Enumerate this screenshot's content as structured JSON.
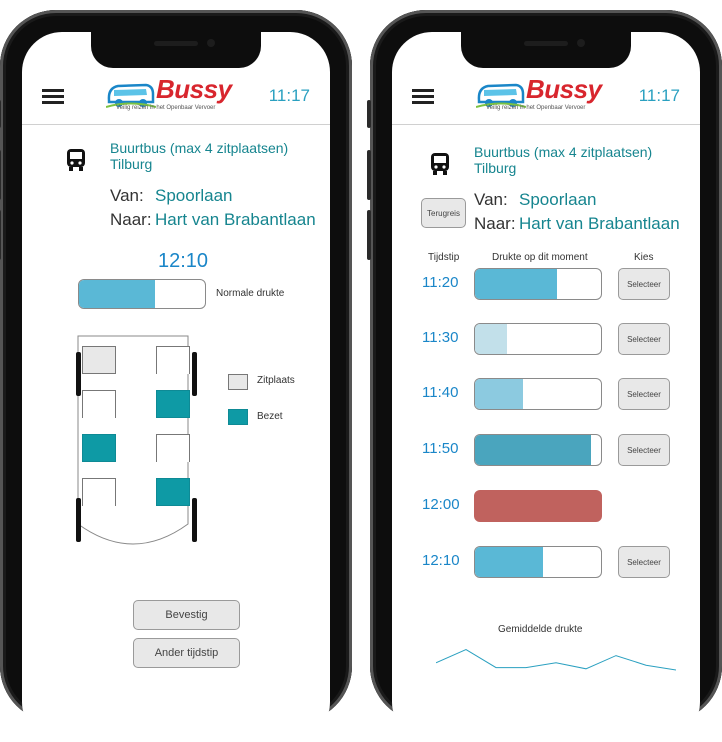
{
  "colors": {
    "teal_text": "#16858f",
    "time_blue": "#2aa0c0",
    "seat_taken": "#0e9aa5",
    "seat_free": "#e8e8e8",
    "bar_red": "#c0625e"
  },
  "header": {
    "time": "11:17",
    "logo_text": "Bussy",
    "logo_tagline": "Veilig reizen in het Openbaar Vervoer",
    "menu_icon": "hamburger-menu-icon"
  },
  "left": {
    "bus_title": "Buurtbus (max 4 zitplaatsen)",
    "bus_city": "Tilburg",
    "van_label": "Van:",
    "van_value": "Spoorlaan",
    "naar_label": "Naar:",
    "naar_value": "Hart van Brabantlaan",
    "departure_time": "12:10",
    "crowd_fraction": 0.6,
    "crowd_label": "Normale drukte",
    "legend_free": "Zitplaats",
    "legend_taken": "Bezet",
    "seats": [
      "free",
      "open",
      "open",
      "taken",
      "taken",
      "open",
      "open",
      "taken"
    ],
    "confirm_button": "Bevestig",
    "other_time_button": "Ander tijdstip"
  },
  "right": {
    "bus_title": "Buurtbus (max 4 zitplaatsen)",
    "bus_city": "Tilburg",
    "return_button": "Terugreis",
    "van_label": "Van:",
    "van_value": "Spoorlaan",
    "naar_label": "Naar:",
    "naar_value": "Hart van Brabantlaan",
    "col_time": "Tijdstip",
    "col_crowd": "Drukte op dit moment",
    "col_choose": "Kies",
    "select_label": "Selecteer",
    "rows": [
      {
        "time": "11:20",
        "fraction": 0.65,
        "color": "#5ab8d6",
        "selectable": true
      },
      {
        "time": "11:30",
        "fraction": 0.25,
        "color": "#c2e0ea",
        "selectable": true
      },
      {
        "time": "11:40",
        "fraction": 0.38,
        "color": "#8ccae0",
        "selectable": true
      },
      {
        "time": "11:50",
        "fraction": 0.92,
        "color": "#4aa5be",
        "selectable": true
      },
      {
        "time": "12:00",
        "fraction": 1.0,
        "color": "#c0625e",
        "selectable": false
      },
      {
        "time": "12:10",
        "fraction": 0.54,
        "color": "#5ab8d6",
        "selectable": true
      }
    ],
    "avg_label": "Gemiddelde drukte",
    "avg_series": [
      0.3,
      0.85,
      0.1,
      0.1,
      0.3,
      0.05,
      0.6,
      0.2,
      0.0
    ]
  }
}
